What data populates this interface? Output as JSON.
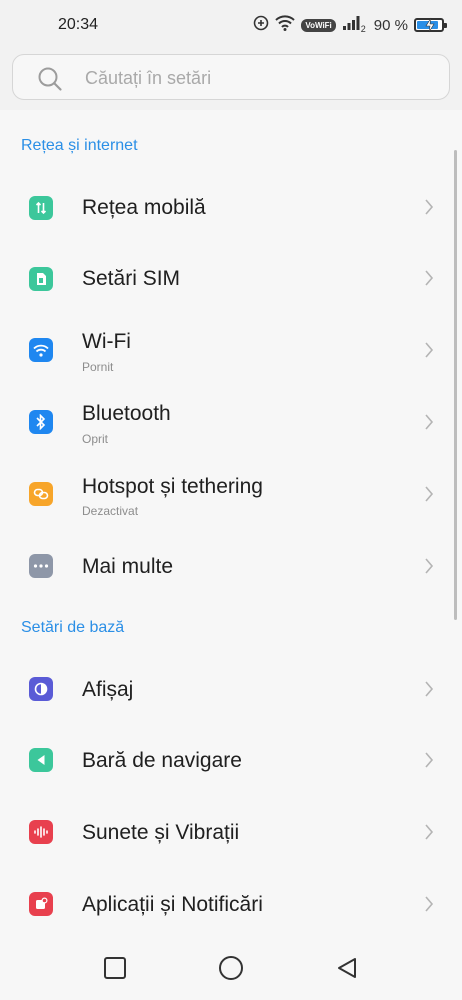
{
  "status_bar": {
    "time": "20:34",
    "volte_label": "VoWiFi",
    "sim_index": "2",
    "battery_percent": "90 %",
    "battery_level": 0.9
  },
  "search": {
    "placeholder": "Căutați în setări"
  },
  "sections": [
    {
      "title": "Rețea și internet",
      "items": [
        {
          "label": "Rețea mobilă",
          "icon": "mobile-data-icon",
          "color": "#3cc79b"
        },
        {
          "label": "Setări SIM",
          "icon": "sim-card-icon",
          "color": "#3cc79b"
        },
        {
          "label": "Wi-Fi",
          "sublabel": "Pornit",
          "icon": "wifi-icon",
          "color": "#1f87f0"
        },
        {
          "label": "Bluetooth",
          "sublabel": "Oprit",
          "icon": "bluetooth-icon",
          "color": "#1f87f0"
        },
        {
          "label": "Hotspot și tethering",
          "sublabel": "Dezactivat",
          "icon": "hotspot-icon",
          "color": "#f7a52a"
        },
        {
          "label": "Mai multe",
          "icon": "more-dots-icon",
          "color": "#8e97a8"
        }
      ]
    },
    {
      "title": "Setări de bază",
      "items": [
        {
          "label": "Afișaj",
          "icon": "display-icon",
          "color": "#5a5bd6"
        },
        {
          "label": "Bară de navigare",
          "icon": "navigation-bar-icon",
          "color": "#3cc79b"
        },
        {
          "label": "Sunete și Vibrații",
          "icon": "sound-wave-icon",
          "color": "#e8404e"
        },
        {
          "label": "Aplicații și Notificări",
          "icon": "app-notification-icon",
          "color": "#e8404e"
        }
      ]
    }
  ],
  "nav_bar": {
    "buttons": [
      "recent-apps",
      "home",
      "back"
    ]
  }
}
